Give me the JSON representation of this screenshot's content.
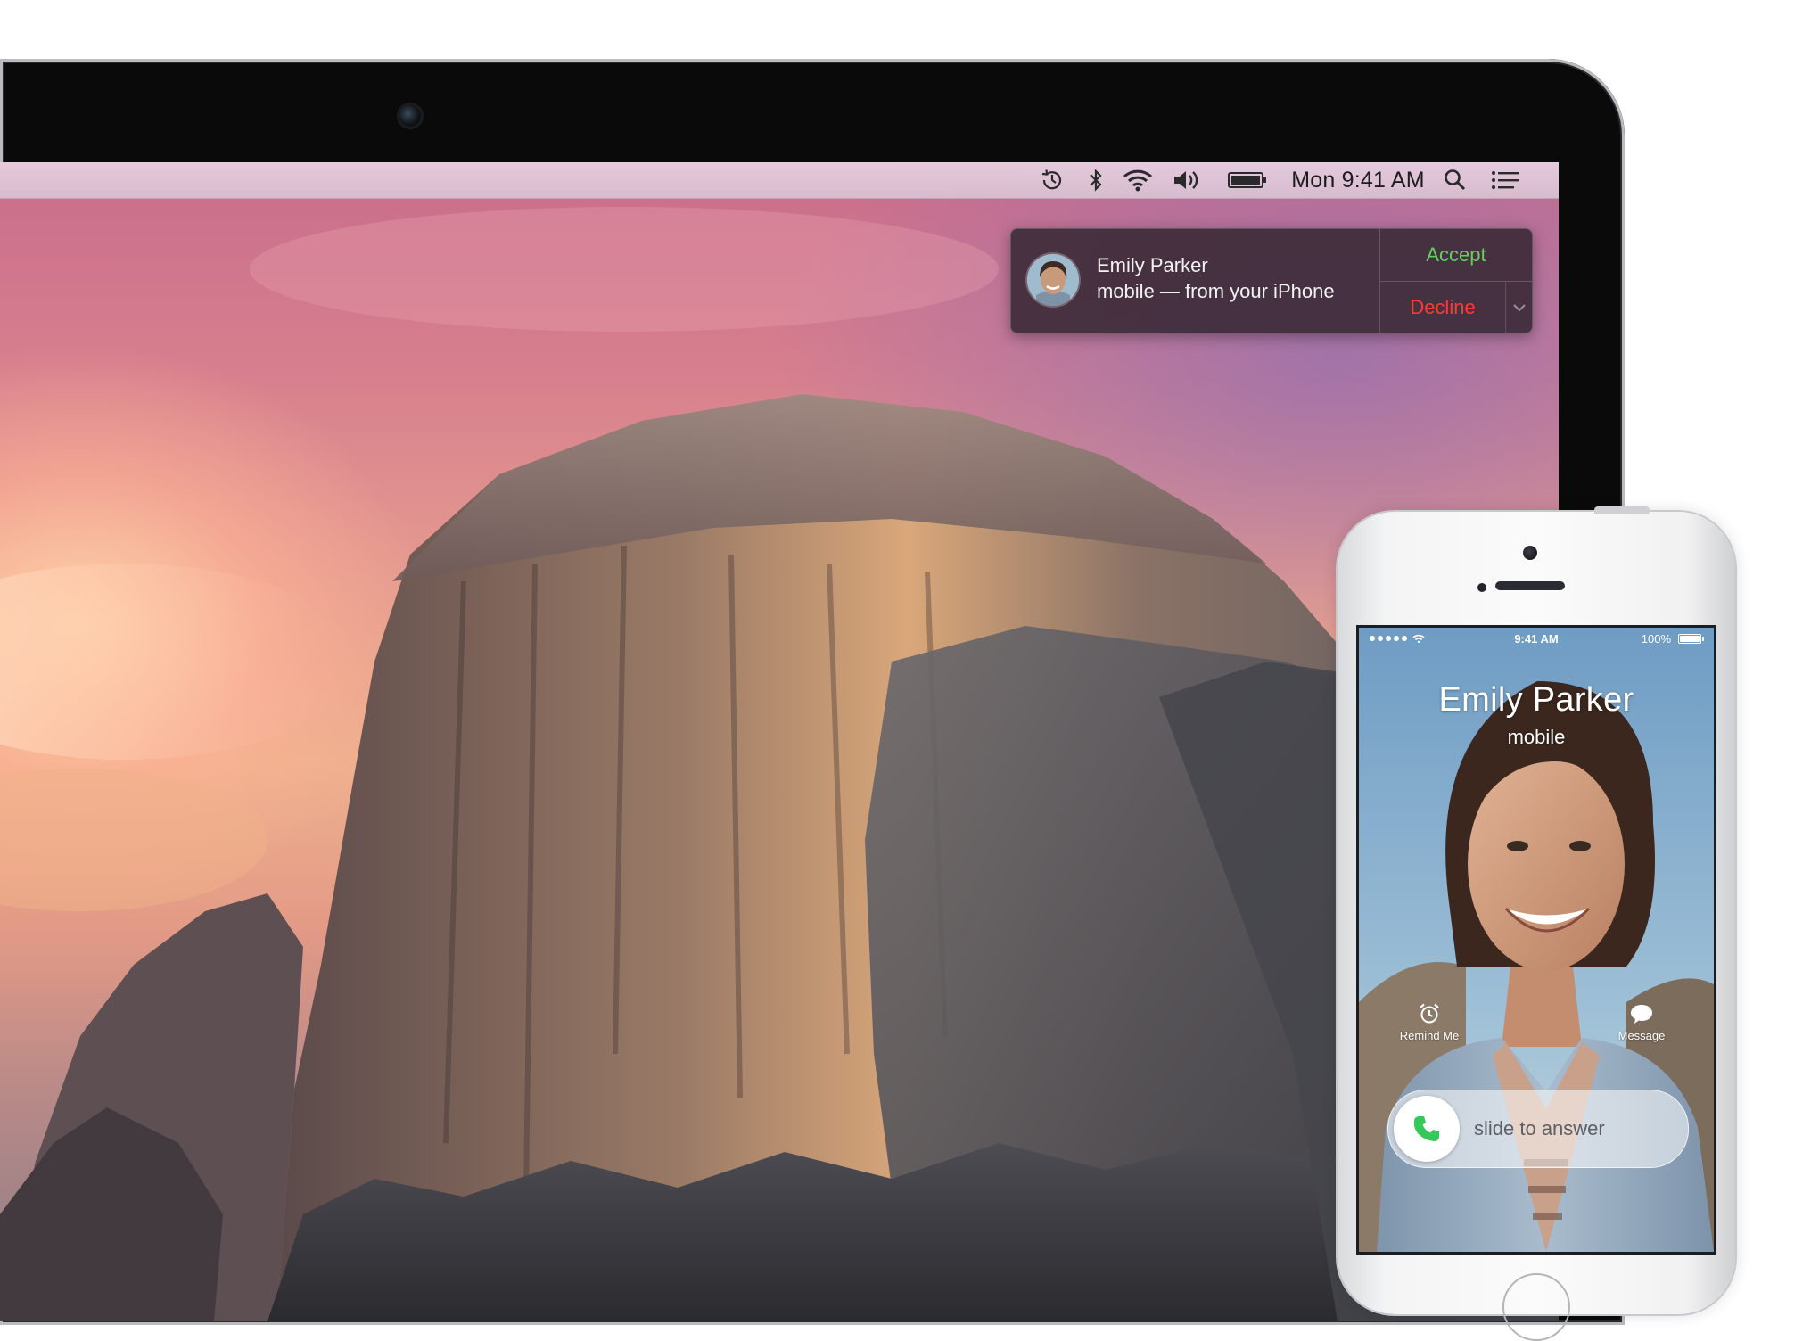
{
  "menubar": {
    "clock": "Mon 9:41 AM",
    "icons": [
      "time-machine-icon",
      "bluetooth-icon",
      "wifi-icon",
      "volume-icon",
      "battery-icon",
      "spotlight-search-icon",
      "notification-center-icon"
    ]
  },
  "notification": {
    "title": "Emily Parker",
    "subtitle": "mobile — from your iPhone",
    "accept_label": "Accept",
    "decline_label": "Decline",
    "accept_color": "#5fd35a",
    "decline_color": "#ff3b30"
  },
  "iphone": {
    "status": {
      "time": "9:41 AM",
      "battery": "100%",
      "battery_level": 1.0
    },
    "caller_name": "Emily Parker",
    "caller_type": "mobile",
    "remind_label": "Remind Me",
    "message_label": "Message",
    "slide_label": "slide to answer",
    "answer_color": "#34c759"
  }
}
